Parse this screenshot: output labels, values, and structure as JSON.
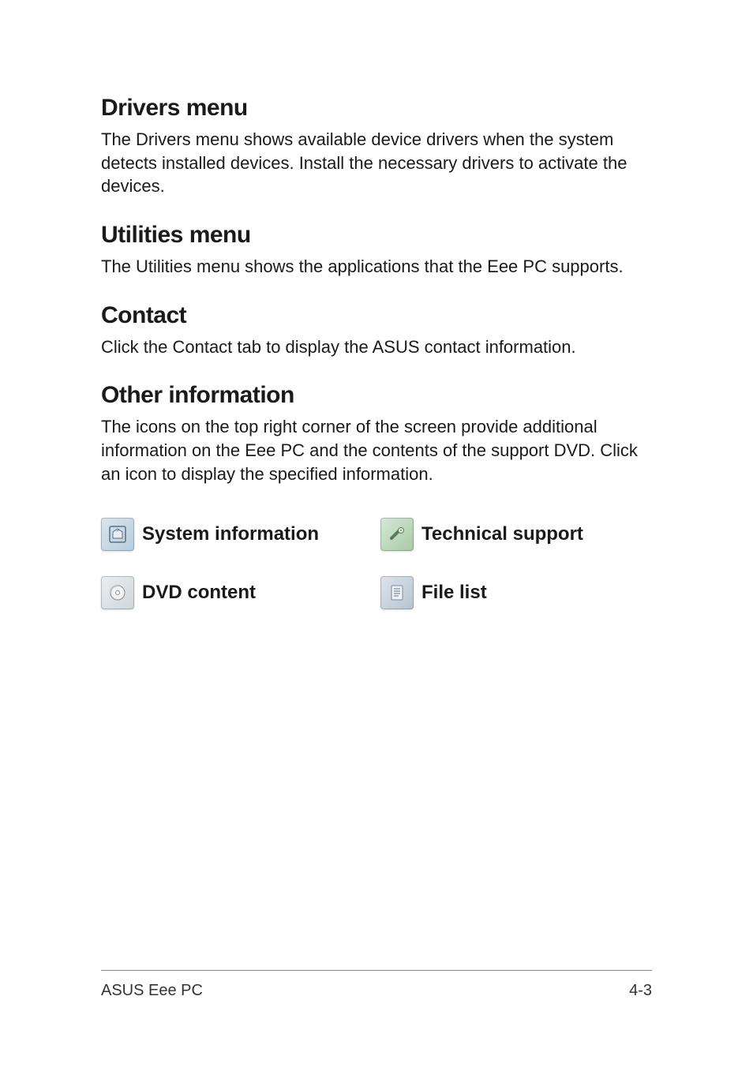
{
  "sections": [
    {
      "heading": "Drivers menu",
      "body": "The Drivers menu shows available device drivers when the system detects installed devices. Install the necessary drivers to activate the devices."
    },
    {
      "heading": "Utilities menu",
      "body": "The Utilities menu shows the applications that the Eee PC supports."
    },
    {
      "heading": "Contact",
      "body": "Click the Contact tab to display the ASUS contact information."
    },
    {
      "heading": "Other information",
      "body": "The icons on the top right corner of the screen provide additional information on the Eee PC and the contents of the support DVD. Click an icon to display the specified information."
    }
  ],
  "icons": {
    "system_info": "System information",
    "tech_support": "Technical support",
    "dvd_content": "DVD content",
    "file_list": "File list"
  },
  "footer": {
    "left": "ASUS Eee PC",
    "right": "4-3"
  }
}
